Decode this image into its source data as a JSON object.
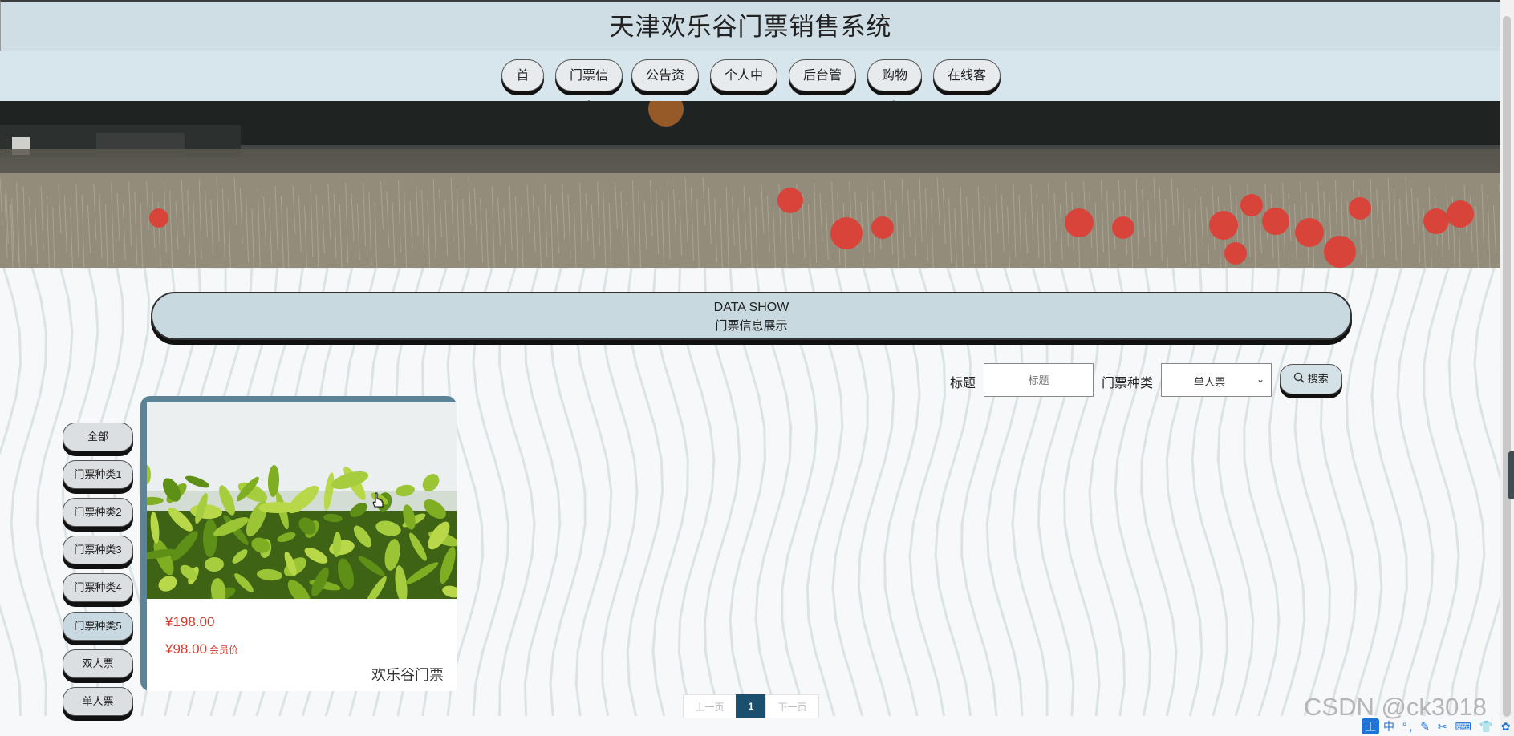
{
  "site": {
    "title": "天津欢乐谷门票销售系统"
  },
  "nav": {
    "items": [
      {
        "label": "首页"
      },
      {
        "label": "门票信息"
      },
      {
        "label": "公告资讯"
      },
      {
        "label": "个人中心"
      },
      {
        "label": "后台管理"
      },
      {
        "label": "购物车"
      },
      {
        "label": "在线客服"
      }
    ]
  },
  "section": {
    "title_en": "DATA SHOW",
    "title_zh": "门票信息展示"
  },
  "search": {
    "title_label": "标题",
    "title_placeholder": "标题",
    "type_label": "门票种类",
    "type_selected": "单人票",
    "button_label": "搜索"
  },
  "categories": [
    {
      "label": "全部"
    },
    {
      "label": "门票种类1"
    },
    {
      "label": "门票种类2"
    },
    {
      "label": "门票种类3"
    },
    {
      "label": "门票种类4"
    },
    {
      "label": "门票种类5"
    },
    {
      "label": "双人票"
    },
    {
      "label": "单人票"
    }
  ],
  "products": [
    {
      "price": "¥198.00",
      "member_price": "¥98.00",
      "member_label": "会员价",
      "name": "欢乐谷门票"
    }
  ],
  "pagination": {
    "prev": "上一页",
    "current": "1",
    "next": "下一页"
  },
  "watermark": "CSDN @ck3018",
  "ime": {
    "logo": "王",
    "items": "中 °, ✎ ✂ ⌨ 👕 ✿"
  },
  "colors": {
    "header_bg": "#cfdde5",
    "nav_bg": "#d7e5ec",
    "card_border": "#5d8496",
    "price": "#d43b2f",
    "pager_active": "#1c4e6e"
  }
}
